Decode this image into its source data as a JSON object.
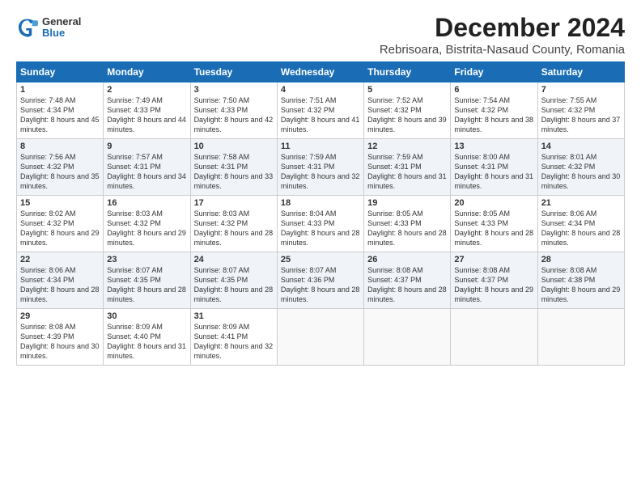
{
  "header": {
    "logo_line1": "General",
    "logo_line2": "Blue",
    "title": "December 2024",
    "subtitle": "Rebrisoara, Bistrita-Nasaud County, Romania"
  },
  "calendar": {
    "days_of_week": [
      "Sunday",
      "Monday",
      "Tuesday",
      "Wednesday",
      "Thursday",
      "Friday",
      "Saturday"
    ],
    "weeks": [
      [
        null,
        {
          "day": 2,
          "sunrise": "7:49 AM",
          "sunset": "4:33 PM",
          "daylight": "8 hours and 44 minutes."
        },
        {
          "day": 3,
          "sunrise": "7:50 AM",
          "sunset": "4:33 PM",
          "daylight": "8 hours and 42 minutes."
        },
        {
          "day": 4,
          "sunrise": "7:51 AM",
          "sunset": "4:32 PM",
          "daylight": "8 hours and 41 minutes."
        },
        {
          "day": 5,
          "sunrise": "7:52 AM",
          "sunset": "4:32 PM",
          "daylight": "8 hours and 39 minutes."
        },
        {
          "day": 6,
          "sunrise": "7:54 AM",
          "sunset": "4:32 PM",
          "daylight": "8 hours and 38 minutes."
        },
        {
          "day": 7,
          "sunrise": "7:55 AM",
          "sunset": "4:32 PM",
          "daylight": "8 hours and 37 minutes."
        }
      ],
      [
        {
          "day": 1,
          "sunrise": "7:48 AM",
          "sunset": "4:34 PM",
          "daylight": "8 hours and 45 minutes."
        },
        null,
        null,
        null,
        null,
        null,
        null
      ],
      [
        {
          "day": 8,
          "sunrise": "7:56 AM",
          "sunset": "4:32 PM",
          "daylight": "8 hours and 35 minutes."
        },
        {
          "day": 9,
          "sunrise": "7:57 AM",
          "sunset": "4:31 PM",
          "daylight": "8 hours and 34 minutes."
        },
        {
          "day": 10,
          "sunrise": "7:58 AM",
          "sunset": "4:31 PM",
          "daylight": "8 hours and 33 minutes."
        },
        {
          "day": 11,
          "sunrise": "7:59 AM",
          "sunset": "4:31 PM",
          "daylight": "8 hours and 32 minutes."
        },
        {
          "day": 12,
          "sunrise": "7:59 AM",
          "sunset": "4:31 PM",
          "daylight": "8 hours and 31 minutes."
        },
        {
          "day": 13,
          "sunrise": "8:00 AM",
          "sunset": "4:31 PM",
          "daylight": "8 hours and 31 minutes."
        },
        {
          "day": 14,
          "sunrise": "8:01 AM",
          "sunset": "4:32 PM",
          "daylight": "8 hours and 30 minutes."
        }
      ],
      [
        {
          "day": 15,
          "sunrise": "8:02 AM",
          "sunset": "4:32 PM",
          "daylight": "8 hours and 29 minutes."
        },
        {
          "day": 16,
          "sunrise": "8:03 AM",
          "sunset": "4:32 PM",
          "daylight": "8 hours and 29 minutes."
        },
        {
          "day": 17,
          "sunrise": "8:03 AM",
          "sunset": "4:32 PM",
          "daylight": "8 hours and 28 minutes."
        },
        {
          "day": 18,
          "sunrise": "8:04 AM",
          "sunset": "4:33 PM",
          "daylight": "8 hours and 28 minutes."
        },
        {
          "day": 19,
          "sunrise": "8:05 AM",
          "sunset": "4:33 PM",
          "daylight": "8 hours and 28 minutes."
        },
        {
          "day": 20,
          "sunrise": "8:05 AM",
          "sunset": "4:33 PM",
          "daylight": "8 hours and 28 minutes."
        },
        {
          "day": 21,
          "sunrise": "8:06 AM",
          "sunset": "4:34 PM",
          "daylight": "8 hours and 28 minutes."
        }
      ],
      [
        {
          "day": 22,
          "sunrise": "8:06 AM",
          "sunset": "4:34 PM",
          "daylight": "8 hours and 28 minutes."
        },
        {
          "day": 23,
          "sunrise": "8:07 AM",
          "sunset": "4:35 PM",
          "daylight": "8 hours and 28 minutes."
        },
        {
          "day": 24,
          "sunrise": "8:07 AM",
          "sunset": "4:35 PM",
          "daylight": "8 hours and 28 minutes."
        },
        {
          "day": 25,
          "sunrise": "8:07 AM",
          "sunset": "4:36 PM",
          "daylight": "8 hours and 28 minutes."
        },
        {
          "day": 26,
          "sunrise": "8:08 AM",
          "sunset": "4:37 PM",
          "daylight": "8 hours and 28 minutes."
        },
        {
          "day": 27,
          "sunrise": "8:08 AM",
          "sunset": "4:37 PM",
          "daylight": "8 hours and 29 minutes."
        },
        {
          "day": 28,
          "sunrise": "8:08 AM",
          "sunset": "4:38 PM",
          "daylight": "8 hours and 29 minutes."
        }
      ],
      [
        {
          "day": 29,
          "sunrise": "8:08 AM",
          "sunset": "4:39 PM",
          "daylight": "8 hours and 30 minutes."
        },
        {
          "day": 30,
          "sunrise": "8:09 AM",
          "sunset": "4:40 PM",
          "daylight": "8 hours and 31 minutes."
        },
        {
          "day": 31,
          "sunrise": "8:09 AM",
          "sunset": "4:41 PM",
          "daylight": "8 hours and 32 minutes."
        },
        null,
        null,
        null,
        null
      ]
    ]
  }
}
